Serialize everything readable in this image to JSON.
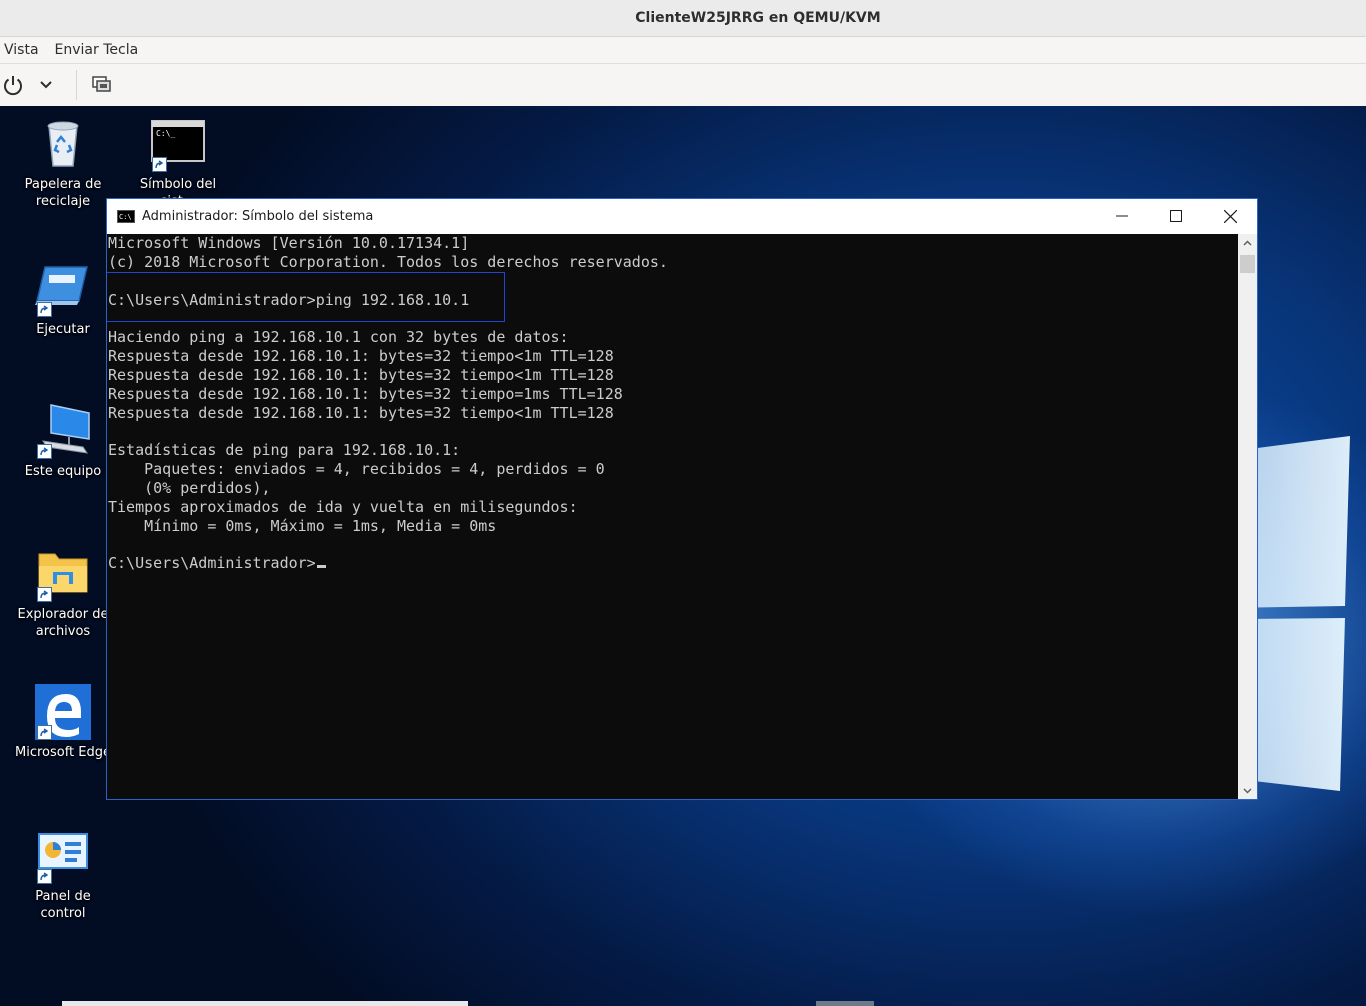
{
  "host": {
    "title": "ClienteW25JRRG en QEMU/KVM",
    "menu": [
      "Vista",
      "Enviar Tecla"
    ],
    "toolbar": {
      "power_icon": "power-icon",
      "dropdown_icon": "chevron-down-icon",
      "console_icon": "screens-icon"
    }
  },
  "desktop": {
    "icons": [
      {
        "label": "Papelera de\nreciclaje",
        "icon": "recycle-bin-icon"
      },
      {
        "label": "Símbolo del\nsist...",
        "icon": "command-prompt-icon"
      },
      {
        "label": "Ejecutar",
        "icon": "run-icon"
      },
      {
        "label": "Este equipo",
        "icon": "computer-icon"
      },
      {
        "label": "Explorador de\narchivos",
        "icon": "folder-icon"
      },
      {
        "label": "Microsoft Edge",
        "icon": "edge-icon"
      },
      {
        "label": "Panel de control",
        "icon": "control-panel-icon"
      }
    ]
  },
  "cmd": {
    "title": "Administrador: Símbolo del sistema",
    "title_icon_text": "C:\\",
    "lines": [
      "Microsoft Windows [Versión 10.0.17134.1]",
      "(c) 2018 Microsoft Corporation. Todos los derechos reservados.",
      "",
      "C:\\Users\\Administrador>ping 192.168.10.1",
      "",
      "Haciendo ping a 192.168.10.1 con 32 bytes de datos:",
      "Respuesta desde 192.168.10.1: bytes=32 tiempo<1m TTL=128",
      "Respuesta desde 192.168.10.1: bytes=32 tiempo<1m TTL=128",
      "Respuesta desde 192.168.10.1: bytes=32 tiempo=1ms TTL=128",
      "Respuesta desde 192.168.10.1: bytes=32 tiempo<1m TTL=128",
      "",
      "Estadísticas de ping para 192.168.10.1:",
      "    Paquetes: enviados = 4, recibidos = 4, perdidos = 0",
      "    (0% perdidos),",
      "Tiempos aproximados de ida y vuelta en milisegundos:",
      "    Mínimo = 0ms, Máximo = 1ms, Media = 0ms",
      ""
    ],
    "prompt": "C:\\Users\\Administrador>"
  },
  "colors": {
    "console_bg": "#0c0c0c",
    "console_fg": "#cccccc",
    "window_border": "#2b63c9",
    "highlight": "#2442d4"
  }
}
